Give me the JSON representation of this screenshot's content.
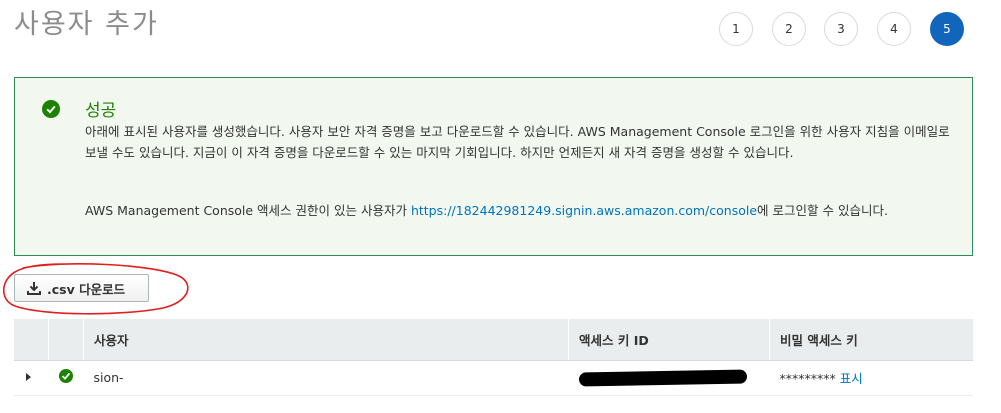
{
  "header": {
    "title": "사용자 추가",
    "steps": [
      "1",
      "2",
      "3",
      "4",
      "5"
    ],
    "active_step": "5"
  },
  "alert": {
    "title": "성공",
    "body": "아래에 표시된 사용자를 생성했습니다. 사용자 보안 자격 증명을 보고 다운로드할 수 있습니다. AWS Management Console 로그인을 위한 사용자 지침을 이메일로 보낼 수도 있습니다. 지금이 이 자격 증명을 다운로드할 수 있는 마지막 기회입니다. 하지만 언제든지 새 자격 증명을 생성할 수 있습니다.",
    "console_prefix": "AWS Management Console 액세스 권한이 있는 사용자가 ",
    "console_link": "https://182442981249.signin.aws.amazon.com/console",
    "console_suffix": "에 로그인할 수 있습니다."
  },
  "toolbar": {
    "download_label": ".csv 다운로드"
  },
  "table": {
    "columns": [
      "사용자",
      "액세스 키 ID",
      "비밀 액세스 키"
    ],
    "rows": [
      {
        "user": "sion-",
        "access_key_id": "",
        "secret_masked": "*********",
        "show_label": "표시"
      }
    ]
  },
  "colors": {
    "success": "#1d8102",
    "link": "#0073bb",
    "active_step": "#1166bb",
    "annotation": "#e02020"
  },
  "icons": {
    "success": "check-circle-icon",
    "download": "download-icon",
    "expand": "caret-right-icon"
  }
}
